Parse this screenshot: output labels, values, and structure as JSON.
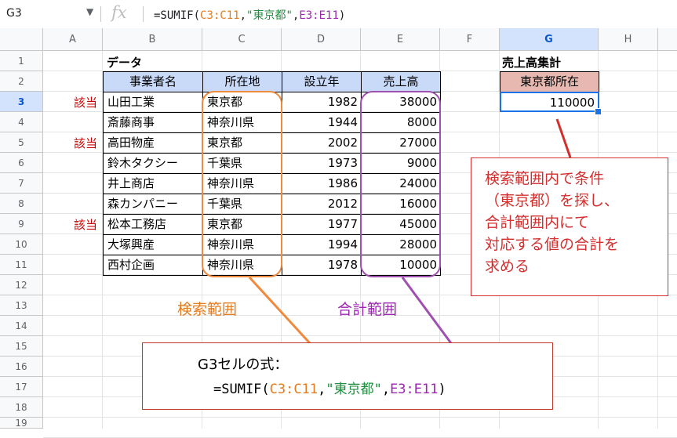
{
  "formula_bar": {
    "name_box": "G3",
    "fx_label": "fx",
    "formula_prefix": "=SUMIF(",
    "formula_range1": "C3:C11",
    "formula_sep1": ",",
    "formula_string": "\"東京都\"",
    "formula_sep2": ",",
    "formula_range2": "E3:E11",
    "formula_suffix": ")"
  },
  "columns": [
    "A",
    "B",
    "C",
    "D",
    "E",
    "F",
    "G",
    "H"
  ],
  "rows": [
    "1",
    "2",
    "3",
    "4",
    "5",
    "6",
    "7",
    "8",
    "9",
    "10",
    "11",
    "12",
    "13",
    "14",
    "15",
    "16",
    "17",
    "18",
    "19"
  ],
  "sheet": {
    "data_title": "データ",
    "headers": [
      "事業者名",
      "所在地",
      "設立年",
      "売上高"
    ],
    "records": [
      {
        "mark": "該当",
        "name": "山田工業",
        "loc": "東京都",
        "year": "1982",
        "sales": "38000"
      },
      {
        "mark": "",
        "name": "斎藤商事",
        "loc": "神奈川県",
        "year": "1944",
        "sales": "8000"
      },
      {
        "mark": "該当",
        "name": "高田物産",
        "loc": "東京都",
        "year": "2002",
        "sales": "27000"
      },
      {
        "mark": "",
        "name": "鈴木タクシー",
        "loc": "千葉県",
        "year": "1973",
        "sales": "9000"
      },
      {
        "mark": "",
        "name": "井上商店",
        "loc": "神奈川県",
        "year": "1986",
        "sales": "24000"
      },
      {
        "mark": "",
        "name": "森カンパニー",
        "loc": "千葉県",
        "year": "2012",
        "sales": "16000"
      },
      {
        "mark": "該当",
        "name": "松本工務店",
        "loc": "東京都",
        "year": "1977",
        "sales": "45000"
      },
      {
        "mark": "",
        "name": "大塚興産",
        "loc": "神奈川県",
        "year": "1994",
        "sales": "28000"
      },
      {
        "mark": "",
        "name": "西村企画",
        "loc": "神奈川県",
        "year": "1978",
        "sales": "10000"
      }
    ],
    "summary_title": "売上高集計",
    "summary_header": "東京都所在",
    "summary_value": "110000"
  },
  "annotations": {
    "search_range_label": "検索範囲",
    "sum_range_label": "合計範囲",
    "explain_lines": [
      "検索範囲内で条件",
      "（東京都）を探し、",
      "合計範囲内にて",
      "対応する値の合計を",
      "求める"
    ],
    "formula_box_title": "G3セルの式：",
    "formula_box_prefix": "=SUMIF(",
    "formula_box_range1": "C3:C11",
    "formula_box_sep1": ",",
    "formula_box_string": "\"東京都\"",
    "formula_box_sep2": ",",
    "formula_box_range2": "E3:E11",
    "formula_box_suffix": ")"
  },
  "colors": {
    "search_orange": "#e67c1c",
    "sum_purple": "#9c27b0",
    "criteria_green": "#1e8e3e",
    "note_red": "#d32f2f",
    "header_blue": "#c9daf8",
    "summary_pink": "#e6b8af"
  }
}
